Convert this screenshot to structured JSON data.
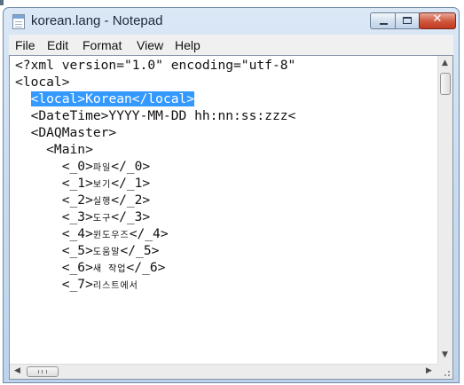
{
  "window": {
    "title": "korean.lang - Notepad",
    "icon": "notepad-icon"
  },
  "title_buttons": {
    "minimize": "minimize-icon",
    "maximize": "maximize-icon",
    "close": "close-icon",
    "close_glyph": "✕"
  },
  "menu": {
    "file": "File",
    "edit": "Edit",
    "format": "Format",
    "view": "View",
    "help": "Help"
  },
  "editor": {
    "lines": [
      {
        "text": "<?xml version=\"1.0\" encoding=\"utf-8\"",
        "selected": false
      },
      {
        "text": "<local>",
        "selected": false
      },
      {
        "text": "  <local>Korean</local>",
        "selected": true
      },
      {
        "text": "  <DateTime>YYYY-MM-DD hh:nn:ss:zzz<",
        "selected": false
      },
      {
        "text": "  <DAQMaster>",
        "selected": false
      },
      {
        "text": "    <Main>",
        "selected": false
      },
      {
        "text": "      <_0>파일</_0>",
        "selected": false
      },
      {
        "text": "      <_1>보기</_1>",
        "selected": false
      },
      {
        "text": "      <_2>실행</_2>",
        "selected": false
      },
      {
        "text": "      <_3>도구</_3>",
        "selected": false
      },
      {
        "text": "      <_4>윈도우즈</_4>",
        "selected": false
      },
      {
        "text": "      <_5>도움말</_5>",
        "selected": false
      },
      {
        "text": "      <_6>새 작업</_6>",
        "selected": false
      },
      {
        "text": "      <_7>리스트에서",
        "selected": false
      }
    ]
  },
  "scrollbars": {
    "up_arrow": "▲",
    "down_arrow": "▼",
    "left_arrow": "◀",
    "right_arrow": "▶"
  }
}
